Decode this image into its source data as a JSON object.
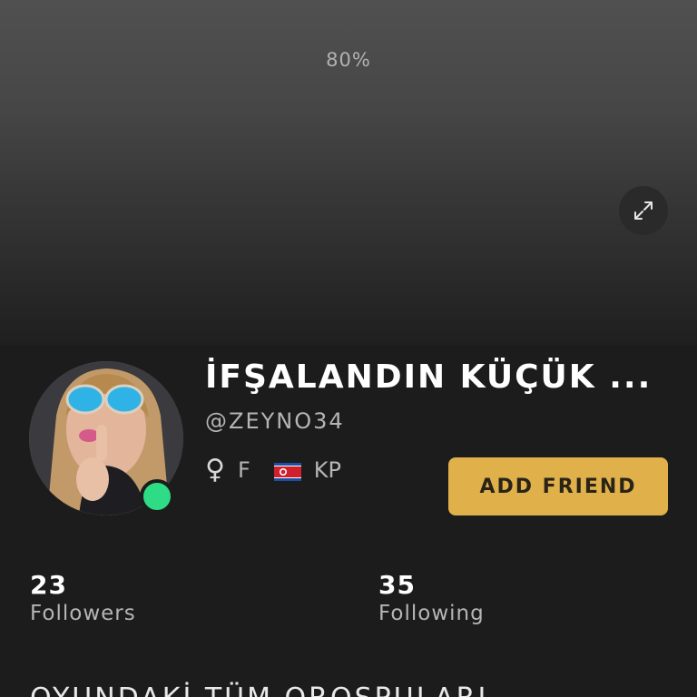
{
  "cover": {
    "progress_text": "80%"
  },
  "profile": {
    "name": "İFŞALANDIN KÜÇÜK ...",
    "handle": "@ZEYNO34",
    "gender_symbol": "♀",
    "gender": "F",
    "country_code": "KP",
    "online": true,
    "add_friend_label": "ADD FRIEND",
    "bio": "OYUNDAKİ TÜM OROSPULARI"
  },
  "stats": {
    "followers": {
      "count": "23",
      "label": "Followers"
    },
    "following": {
      "count": "35",
      "label": "Following"
    }
  },
  "colors": {
    "accent": "#e0b14a",
    "online": "#2edc85",
    "background": "#1c1c1c"
  },
  "icons": {
    "expand": "expand-icon",
    "gender": "female-icon",
    "flag": "flag-kp-icon"
  }
}
